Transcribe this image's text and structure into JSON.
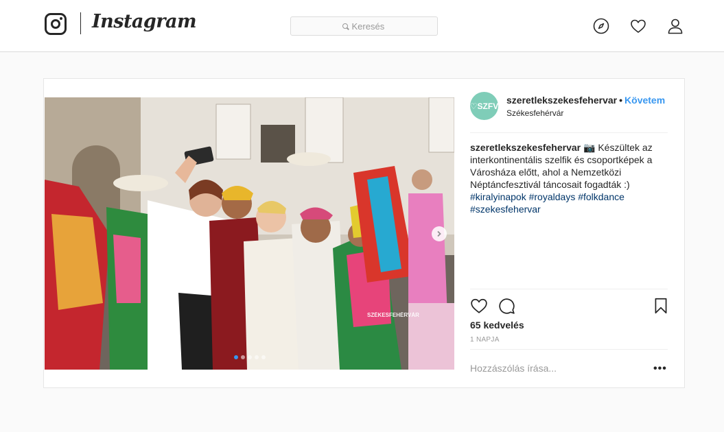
{
  "header": {
    "brand": "Instagram",
    "search_placeholder": "Keresés",
    "icons": [
      "explore-compass-icon",
      "activity-heart-icon",
      "profile-person-icon"
    ]
  },
  "post": {
    "username": "szeretlekszekesfehervar",
    "separator": "•",
    "follow_label": "Követem",
    "location": "Székesfehérvár",
    "avatar_text": "♡SZFV",
    "caption_user": "szeretlekszekesfehervar",
    "caption_emoji": "📷",
    "caption_text": "Készültek az interkontinentális szelfik és csoportképek a Városháza előtt, ahol a Nemzetközi Néptáncfesztivál táncosait fogadták :)",
    "hashtags": [
      "#kiralyinapok",
      "#royaldays",
      "#folkdance",
      "#szekesfehervar"
    ],
    "likes": "65 kedvelés",
    "date": "1 NAPJA",
    "comment_placeholder": "Hozzászólás írása...",
    "more_label": "•••",
    "carousel": {
      "total": 5,
      "active": 1
    },
    "watermark": "SZÉKESFEHÉRVÁR",
    "colors": {
      "link": "#3897f0",
      "hashtag": "#003569",
      "avatar": "#7fcdb8"
    }
  }
}
